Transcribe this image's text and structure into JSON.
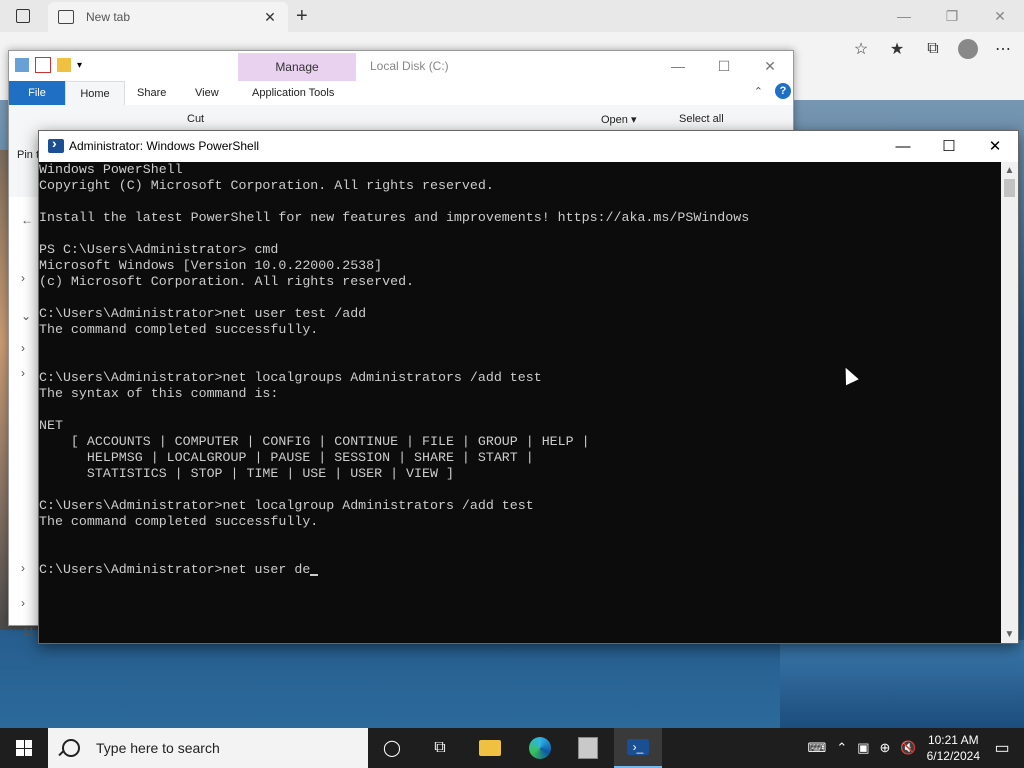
{
  "browser": {
    "tab_title": "New tab",
    "new_tab": "+",
    "window_controls": [
      "—",
      "❐",
      "✕"
    ]
  },
  "explorer": {
    "window_title": "Local Disk (C:)",
    "contextual_tab": "Manage",
    "ribbon_tabs": [
      "File",
      "Home",
      "Share",
      "View",
      "Application Tools"
    ],
    "ribbon_items": [
      "Cut",
      "Open ▾",
      "Select all"
    ],
    "pin_label": "Pin t",
    "nav_count": "11",
    "window_controls": [
      "—",
      "☐",
      "✕"
    ],
    "help": "?"
  },
  "powershell": {
    "title": "Administrator: Windows PowerShell",
    "window_controls": [
      "—",
      "☐",
      "✕"
    ],
    "lines": [
      "Windows PowerShell",
      "Copyright (C) Microsoft Corporation. All rights reserved.",
      "",
      "Install the latest PowerShell for new features and improvements! https://aka.ms/PSWindows",
      "",
      "PS C:\\Users\\Administrator> cmd",
      "Microsoft Windows [Version 10.0.22000.2538]",
      "(c) Microsoft Corporation. All rights reserved.",
      "",
      "C:\\Users\\Administrator>net user test /add",
      "The command completed successfully.",
      "",
      "",
      "C:\\Users\\Administrator>net localgroups Administrators /add test",
      "The syntax of this command is:",
      "",
      "NET",
      "    [ ACCOUNTS | COMPUTER | CONFIG | CONTINUE | FILE | GROUP | HELP |",
      "      HELPMSG | LOCALGROUP | PAUSE | SESSION | SHARE | START |",
      "      STATISTICS | STOP | TIME | USE | USER | VIEW ]",
      "",
      "C:\\Users\\Administrator>net localgroup Administrators /add test",
      "The command completed successfully.",
      "",
      ""
    ],
    "current_input": "C:\\Users\\Administrator>net user de"
  },
  "taskbar": {
    "search_placeholder": "Type here to search",
    "time": "10:21 AM",
    "date": "6/12/2024"
  }
}
